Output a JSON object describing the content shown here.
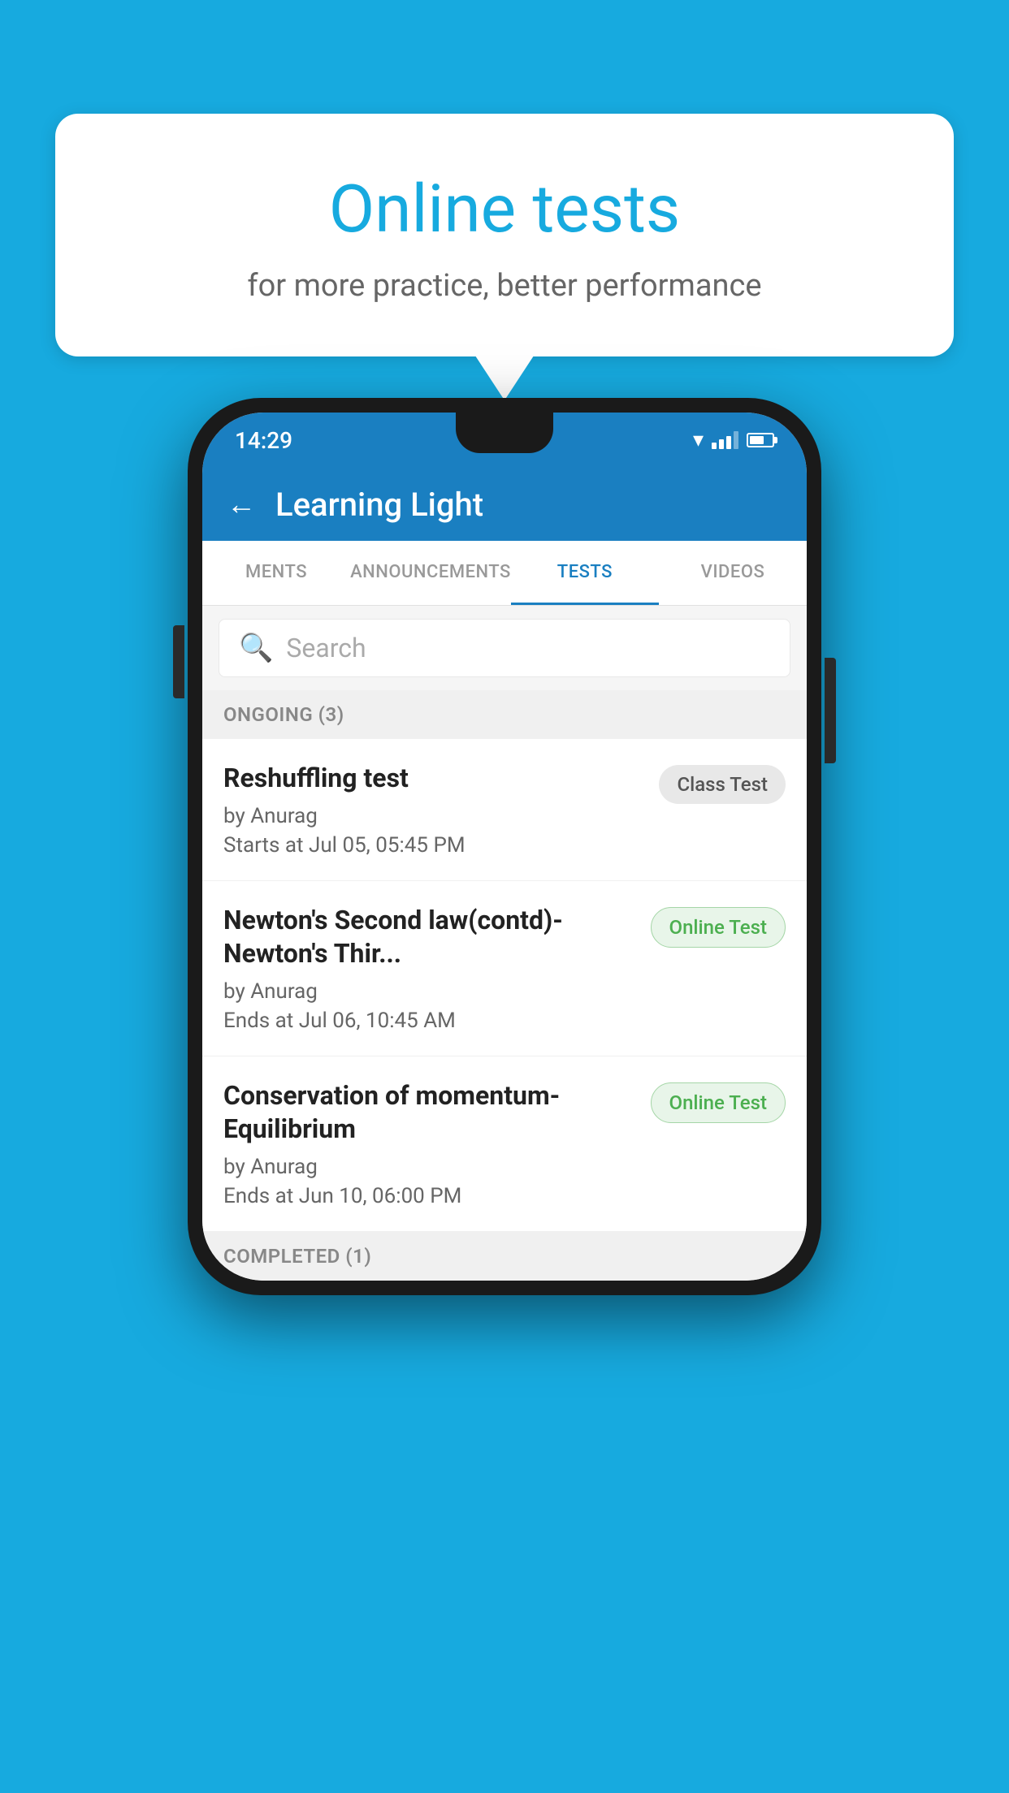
{
  "background": {
    "color": "#17AADF"
  },
  "speech_bubble": {
    "title": "Online tests",
    "subtitle": "for more practice, better performance"
  },
  "phone": {
    "status_bar": {
      "time": "14:29"
    },
    "header": {
      "title": "Learning Light",
      "back_label": "←"
    },
    "tabs": [
      {
        "label": "MENTS",
        "active": false
      },
      {
        "label": "ANNOUNCEMENTS",
        "active": false
      },
      {
        "label": "TESTS",
        "active": true
      },
      {
        "label": "VIDEOS",
        "active": false
      }
    ],
    "search": {
      "placeholder": "Search"
    },
    "ongoing_section": {
      "label": "ONGOING (3)"
    },
    "tests": [
      {
        "title": "Reshuffling test",
        "author": "by Anurag",
        "date": "Starts at  Jul 05, 05:45 PM",
        "badge": "Class Test",
        "badge_type": "class"
      },
      {
        "title": "Newton's Second law(contd)-Newton's Thir...",
        "author": "by Anurag",
        "date": "Ends at  Jul 06, 10:45 AM",
        "badge": "Online Test",
        "badge_type": "online"
      },
      {
        "title": "Conservation of momentum-Equilibrium",
        "author": "by Anurag",
        "date": "Ends at  Jun 10, 06:00 PM",
        "badge": "Online Test",
        "badge_type": "online"
      }
    ],
    "completed_section": {
      "label": "COMPLETED (1)"
    }
  }
}
